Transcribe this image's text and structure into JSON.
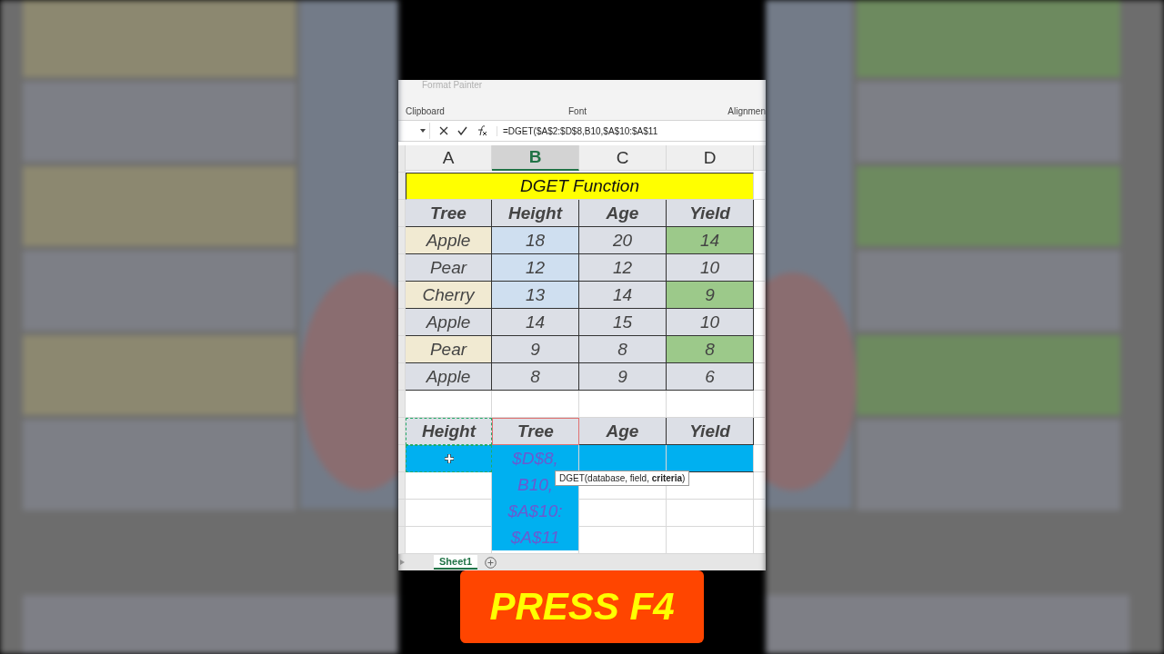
{
  "ribbon": {
    "faded_command": "Format Painter",
    "groups": [
      "Clipboard",
      "Font",
      "Alignmen"
    ]
  },
  "formula_bar": {
    "formula": "=DGET($A$2:$D$8,B10,$A$10:$A$11"
  },
  "columns": [
    {
      "label": "A",
      "selected": false
    },
    {
      "label": "B",
      "selected": true
    },
    {
      "label": "C",
      "selected": false
    },
    {
      "label": "D",
      "selected": false
    }
  ],
  "title": "DGET Function",
  "table": {
    "headers": [
      "Tree",
      "Height",
      "Age",
      "Yield"
    ],
    "rows": [
      {
        "cells": [
          "Apple",
          "18",
          "20",
          "14"
        ],
        "highlight": true
      },
      {
        "cells": [
          "Pear",
          "12",
          "12",
          "10"
        ],
        "highlight": false
      },
      {
        "cells": [
          "Cherry",
          "13",
          "14",
          "9"
        ],
        "highlight": true
      },
      {
        "cells": [
          "Apple",
          "14",
          "15",
          "10"
        ],
        "highlight": false
      },
      {
        "cells": [
          "Pear",
          "9",
          "8",
          "8"
        ],
        "highlight": true
      },
      {
        "cells": [
          "Apple",
          "8",
          "9",
          "6"
        ],
        "highlight": false
      }
    ]
  },
  "criteria": {
    "headers": [
      "Height",
      "Tree",
      "Age",
      "Yield"
    ]
  },
  "edit_cell": {
    "lines": [
      "$D$8,",
      "B10,",
      "$A$10:",
      "$A$11"
    ]
  },
  "tooltip": "DGET(database, field, **criteria**)",
  "sheet_tabs": [
    {
      "label": "Sheet1",
      "selected": true
    }
  ],
  "caption": "PRESS F4"
}
